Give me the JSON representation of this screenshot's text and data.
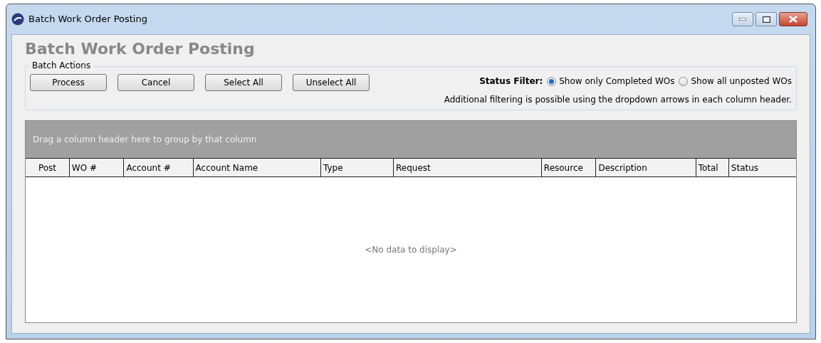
{
  "window": {
    "title": "Batch Work Order Posting"
  },
  "heading": "Batch Work Order Posting",
  "batch_actions": {
    "legend": "Batch Actions",
    "buttons": [
      "Process",
      "Cancel",
      "Select All",
      "Unselect All"
    ]
  },
  "status_filter": {
    "label": "Status Filter:",
    "options": [
      {
        "label": "Show only Completed WOs",
        "selected": true
      },
      {
        "label": "Show all unposted WOs",
        "selected": false
      }
    ],
    "note": "Additional filtering is possible using the dropdown arrows in each column header."
  },
  "grid": {
    "group_panel": "Drag a column header here to group by that column",
    "columns": [
      {
        "label": "Post"
      },
      {
        "label": "WO #"
      },
      {
        "label": "Account #"
      },
      {
        "label": "Account Name"
      },
      {
        "label": "Type"
      },
      {
        "label": "Request"
      },
      {
        "label": "Resource"
      },
      {
        "label": "Description"
      },
      {
        "label": "Total"
      },
      {
        "label": "Status"
      }
    ],
    "empty_text": "<No data to display>"
  }
}
